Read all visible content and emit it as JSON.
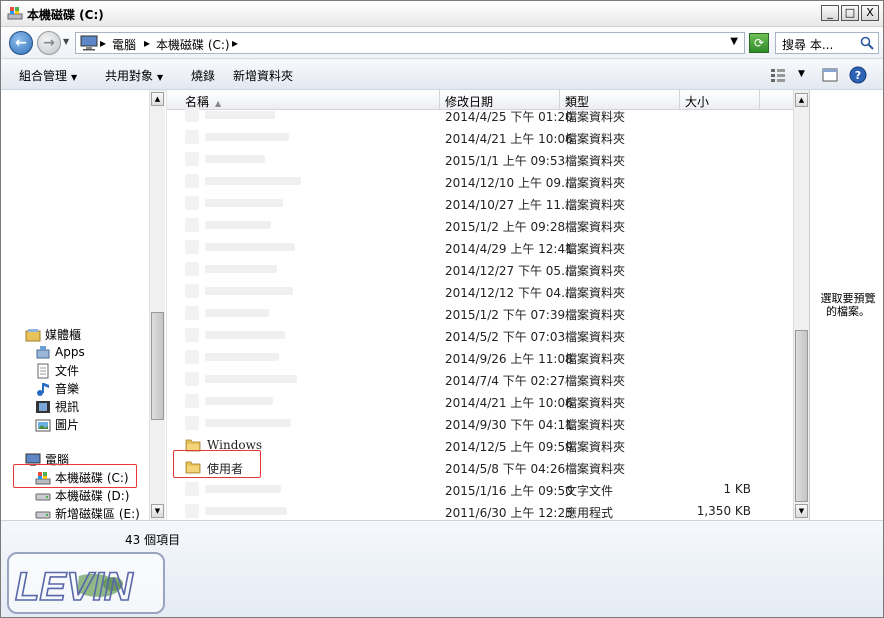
{
  "window": {
    "title": "本機磁碟 (C:)",
    "controls": {
      "minimize": "_",
      "maximize": "□",
      "close": "X"
    }
  },
  "address": {
    "crumbs": [
      "電腦",
      "本機磁碟 (C:)"
    ],
    "search_placeholder": "搜尋 本..."
  },
  "toolbar": {
    "organize": "組合管理",
    "share": "共用對象",
    "burn": "燒錄",
    "new_folder": "新增資料夾"
  },
  "nav": {
    "libraries": "媒體櫃",
    "library_items": [
      "Apps",
      "文件",
      "音樂",
      "視訊",
      "圖片"
    ],
    "computer": "電腦",
    "drives": [
      "本機磁碟 (C:)",
      "本機磁碟 (D:)",
      "新增磁碟區 (E:)"
    ]
  },
  "columns": {
    "name": "名稱",
    "date": "修改日期",
    "type": "類型",
    "size": "大小"
  },
  "rows": [
    {
      "name": "",
      "date": "2014/4/25 下午 01:20",
      "type": "檔案資料夾",
      "size": ""
    },
    {
      "name": "",
      "date": "2014/4/21 上午 10:06",
      "type": "檔案資料夾",
      "size": ""
    },
    {
      "name": "",
      "date": "2015/1/1 上午 09:53",
      "type": "檔案資料夾",
      "size": ""
    },
    {
      "name": "",
      "date": "2014/12/10 上午 09...",
      "type": "檔案資料夾",
      "size": ""
    },
    {
      "name": "",
      "date": "2014/10/27 上午 11...",
      "type": "檔案資料夾",
      "size": ""
    },
    {
      "name": "",
      "date": "2015/1/2 上午 09:28",
      "type": "檔案資料夾",
      "size": ""
    },
    {
      "name": "",
      "date": "2014/4/29 上午 12:41",
      "type": "檔案資料夾",
      "size": ""
    },
    {
      "name": "",
      "date": "2014/12/27 下午 05...",
      "type": "檔案資料夾",
      "size": ""
    },
    {
      "name": "",
      "date": "2014/12/12 下午 04...",
      "type": "檔案資料夾",
      "size": ""
    },
    {
      "name": "",
      "date": "2015/1/2 下午 07:39",
      "type": "檔案資料夾",
      "size": ""
    },
    {
      "name": "",
      "date": "2014/5/2 下午 07:03",
      "type": "檔案資料夾",
      "size": ""
    },
    {
      "name": "",
      "date": "2014/9/26 上午 11:08",
      "type": "檔案資料夾",
      "size": ""
    },
    {
      "name": "",
      "date": "2014/7/4 下午 02:27",
      "type": "檔案資料夾",
      "size": ""
    },
    {
      "name": "",
      "date": "2014/4/21 上午 10:06",
      "type": "檔案資料夾",
      "size": ""
    },
    {
      "name": "",
      "date": "2014/9/30 下午 04:11",
      "type": "檔案資料夾",
      "size": ""
    },
    {
      "name": "Windows",
      "date": "2014/12/5 上午 09:59",
      "type": "檔案資料夾",
      "size": ""
    },
    {
      "name": "使用者",
      "date": "2014/5/8 下午 04:26",
      "type": "檔案資料夾",
      "size": ""
    },
    {
      "name": "",
      "date": "2015/1/16 上午 09:50",
      "type": "文字文件",
      "size": "1 KB"
    },
    {
      "name": "",
      "date": "2011/6/30 上午 12:25",
      "type": "應用程式",
      "size": "1,350 KB"
    }
  ],
  "preview": {
    "text": "選取要預覽的檔案。"
  },
  "status": {
    "count": "43 個項目"
  },
  "watermark": {
    "text": "LEVIN"
  },
  "colors": {
    "highlight": "#e53935",
    "folder": "#e8c25a"
  }
}
